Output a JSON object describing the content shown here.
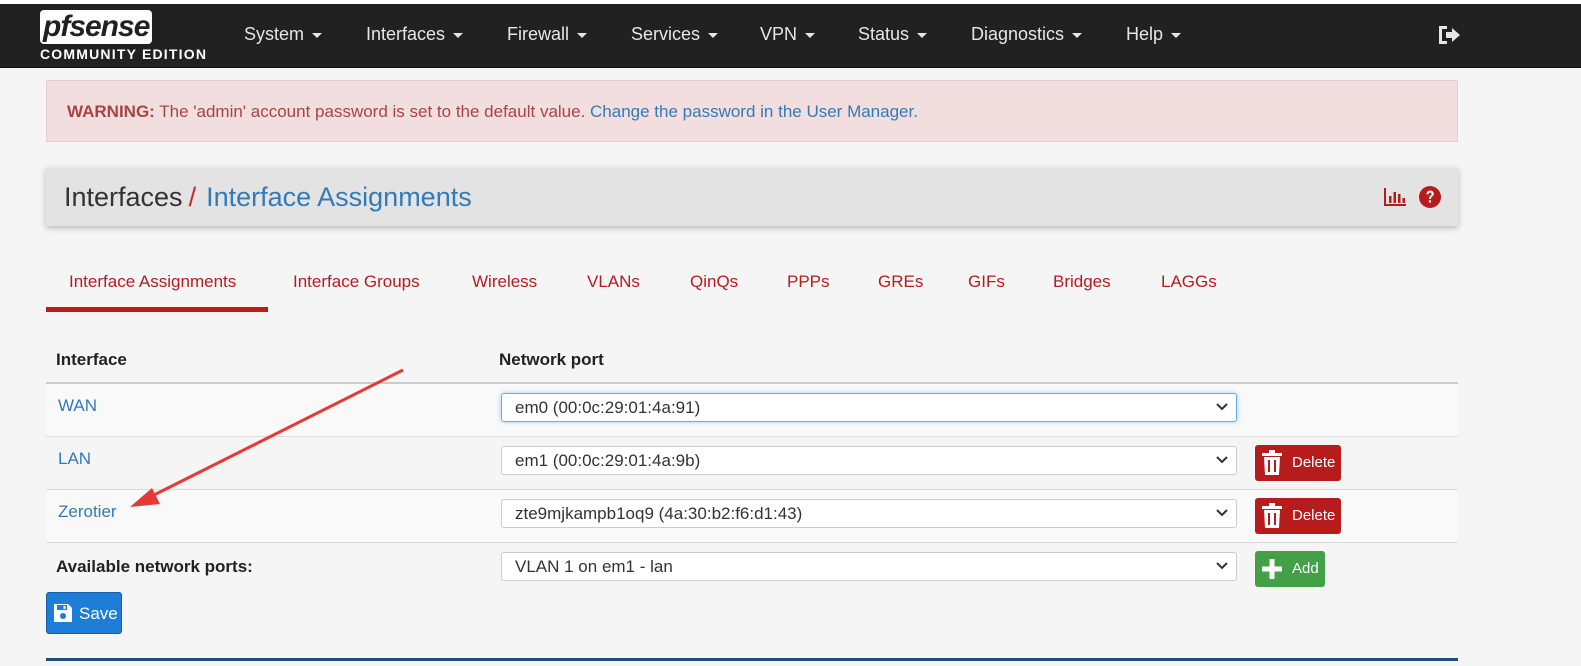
{
  "navbar": {
    "logo_brand": "pfsense",
    "logo_edition": "COMMUNITY EDITION",
    "menu": [
      "System",
      "Interfaces",
      "Firewall",
      "Services",
      "VPN",
      "Status",
      "Diagnostics",
      "Help"
    ],
    "logout_icon": "sign-out-icon"
  },
  "alert": {
    "strong": "WARNING:",
    "text": " The 'admin' account password is set to the default value. ",
    "link": "Change the password in the User Manager."
  },
  "breadcrumb": {
    "part1": "Interfaces",
    "separator": "/",
    "part2": "Interface Assignments",
    "icons": [
      "bar-chart-icon",
      "question-circle-icon"
    ]
  },
  "tabs": {
    "active": "Interface Assignments",
    "items": [
      "Interface Assignments",
      "Interface Groups",
      "Wireless",
      "VLANs",
      "QinQs",
      "PPPs",
      "GREs",
      "GIFs",
      "Bridges",
      "LAGGs"
    ]
  },
  "table": {
    "headers": {
      "interface": "Interface",
      "port": "Network port"
    },
    "rows": [
      {
        "interface": "WAN",
        "port": "em0 (00:0c:29:01:4a:91)",
        "action": ""
      },
      {
        "interface": "LAN",
        "port": "em1 (00:0c:29:01:4a:9b)",
        "action": "Delete"
      },
      {
        "interface": "Zerotier",
        "port": "zte9mjkampb1oq9 (4a:30:b2:f6:d1:43)",
        "action": "Delete"
      }
    ],
    "available": {
      "label": "Available network ports:",
      "port": "VLAN 1 on em1 - lan",
      "action": "Add"
    }
  },
  "save_label": "Save",
  "colors": {
    "navbar": "#212121",
    "accent_red": "#b71c1c",
    "link_blue": "#337ab7",
    "add_green": "#43a047",
    "save_blue": "#1e7dd6",
    "annotation_arrow": "#e53935"
  }
}
